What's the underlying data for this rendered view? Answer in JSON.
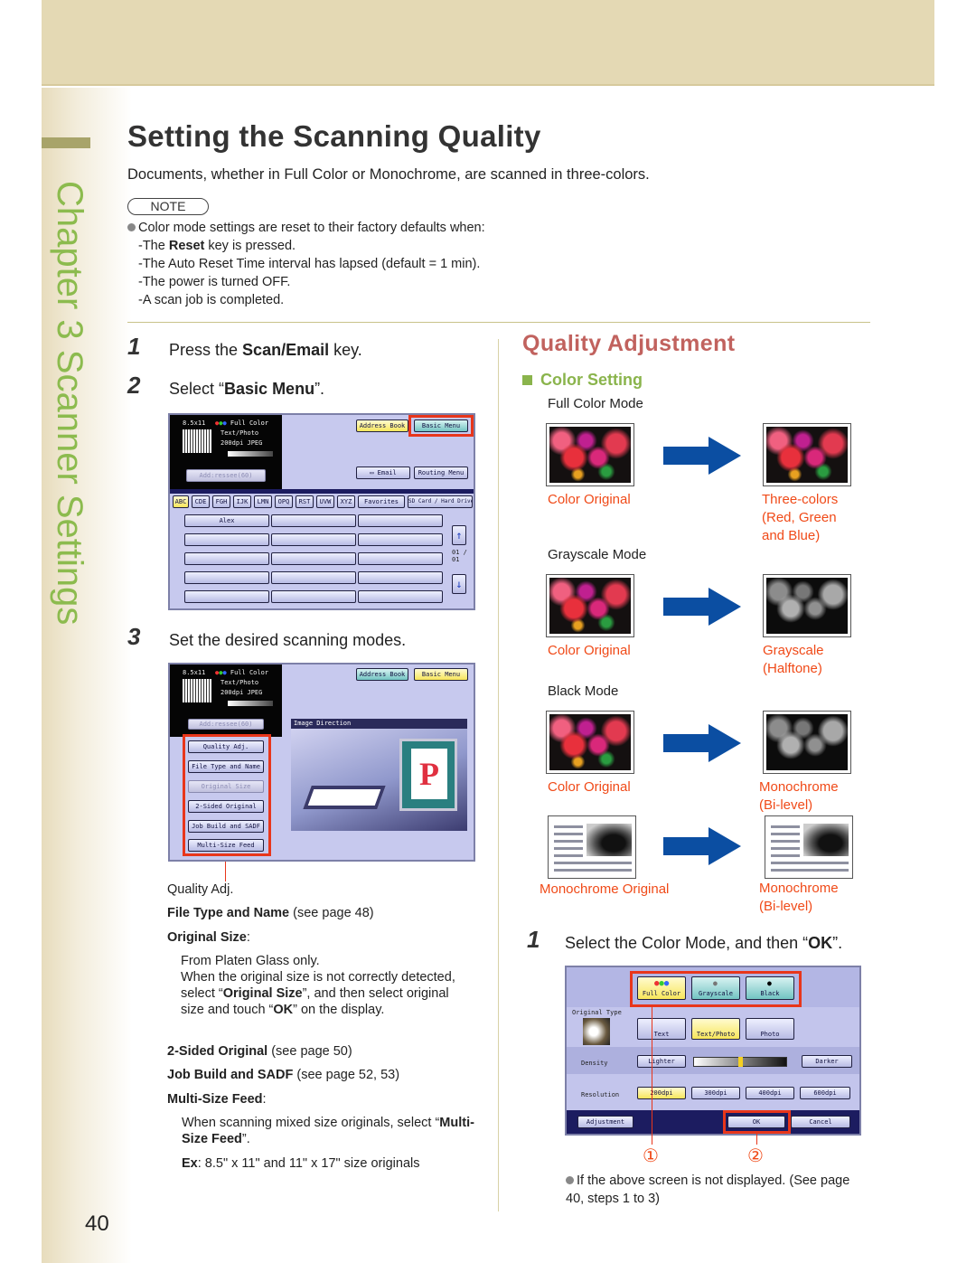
{
  "chapter": {
    "label": "Chapter 3   Scanner Settings"
  },
  "page": {
    "title": "Setting the Scanning Quality",
    "intro": "Documents, whether in Full Color or Monochrome, are scanned in three-colors.",
    "number": "40"
  },
  "note": {
    "badge": "NOTE",
    "lead": "Color mode settings are reset to their factory defaults when:",
    "items": [
      {
        "pre": "-The ",
        "bold": "Reset",
        "post": " key is pressed."
      },
      {
        "pre": "-The Auto Reset Time interval has lapsed (default = 1 min).",
        "bold": "",
        "post": ""
      },
      {
        "pre": "-The power is turned OFF.",
        "bold": "",
        "post": ""
      },
      {
        "pre": "-A scan job is completed.",
        "bold": "",
        "post": ""
      }
    ]
  },
  "steps_left": [
    {
      "num": "1",
      "pre": "Press the ",
      "bold": "Scan/Email",
      "post": " key."
    },
    {
      "num": "2",
      "pre": "Select “",
      "bold": "Basic Menu",
      "post": "”."
    },
    {
      "num": "3",
      "pre": "Set the desired scanning modes.",
      "bold": "",
      "post": ""
    }
  ],
  "screen1": {
    "status": {
      "size": "8.5x11",
      "color": "Full Color",
      "type": "Text/Photo",
      "res": "200dpi JPEG"
    },
    "addr_button": "Add:ressee(60)",
    "top_buttons": [
      "Address Book",
      "Basic Menu"
    ],
    "mid_buttons": [
      "Email",
      "Routing Menu"
    ],
    "tabs": [
      "ABC",
      "CDE",
      "FGH",
      "IJK",
      "LMN",
      "OPQ",
      "RST",
      "UVW",
      "XYZ",
      "Favorites",
      "SD Card / Hard Drive"
    ],
    "first_entry": "Alex",
    "page_indicator": "01 / 01"
  },
  "screen2": {
    "status": {
      "size": "8.5x11",
      "color": "Full Color",
      "type": "Text/Photo",
      "res": "200dpi JPEG"
    },
    "addr_button": "Add:ressee(60)",
    "top_buttons": [
      "Address Book",
      "Basic Menu"
    ],
    "menu": [
      "Quality Adj.",
      "File Type and Name",
      "Original Size",
      "2-Sided Original",
      "Job Build and SADF",
      "Multi-Size Feed"
    ],
    "image_panel_title": "Image Direction",
    "callout": "Quality Adj."
  },
  "options": {
    "file_type": {
      "bold": "File Type and Name",
      "rest": " (see page 48)"
    },
    "original_size": {
      "bold": "Original Size",
      "rest": ":"
    },
    "original_size_desc": {
      "line1": "From Platen Glass only.",
      "line2_pre": "When the original size is not correctly detected, select “",
      "line2_bold": "Original Size",
      "line2_mid": "”, and then select original size and touch “",
      "line2_bold2": "OK",
      "line2_post": "” on the display."
    },
    "two_sided": {
      "bold": "2-Sided Original",
      "rest": " (see page 50)"
    },
    "job_build": {
      "bold": "Job Build and SADF",
      "rest": " (see page 52, 53)"
    },
    "multi_size": {
      "bold": "Multi-Size Feed",
      "rest": ":"
    },
    "multi_size_desc": {
      "pre": "When scanning mixed size originals, select “",
      "bold": "Multi-Size Feed",
      "post": "”."
    },
    "example": {
      "bold": "Ex",
      "rest": ": 8.5\" x 11\" and 11\" x 17\" size originals"
    }
  },
  "quality": {
    "title": "Quality Adjustment",
    "subtitle": "Color Setting",
    "modes": [
      {
        "name": "Full Color Mode",
        "from": "Color Original",
        "to": [
          "Three-colors",
          "(Red, Green",
          "and Blue)"
        ]
      },
      {
        "name": "Grayscale Mode",
        "from": "Color Original",
        "to": [
          "Grayscale",
          "(Halftone)"
        ]
      },
      {
        "name": "Black Mode",
        "from": "Color Original",
        "to": [
          "Monochrome",
          "(Bi-level)"
        ]
      },
      {
        "name": "",
        "from": "Monochrome Original",
        "to": [
          "Monochrome",
          "(Bi-level)"
        ]
      }
    ]
  },
  "step_right": {
    "num": "1",
    "pre": "Select the Color Mode, and then “",
    "bold": "OK",
    "post": "”."
  },
  "screen3": {
    "color_buttons": [
      "Full Color",
      "Grayscale",
      "Black"
    ],
    "original_type_label": "Original Type",
    "original_types": [
      "Text",
      "Text/Photo",
      "Photo"
    ],
    "density_label": "Density",
    "density_buttons": [
      "Lighter",
      "Darker"
    ],
    "density_level": 0.5,
    "resolution_label": "Resolution",
    "resolutions": [
      "200dpi",
      "300dpi",
      "400dpi",
      "600dpi"
    ],
    "bottom_buttons": [
      "Adjustment",
      "OK",
      "Cancel"
    ],
    "callouts": [
      "①",
      "②"
    ]
  },
  "bottom_note": "If the above screen is not displayed. (See page 40, steps 1 to 3)",
  "colors": {
    "accent_red": "#e8361b",
    "orange_text": "#f04a18",
    "green": "#8ab44c",
    "title_red": "#c1625e",
    "arrow_blue": "#0b4ea2"
  }
}
